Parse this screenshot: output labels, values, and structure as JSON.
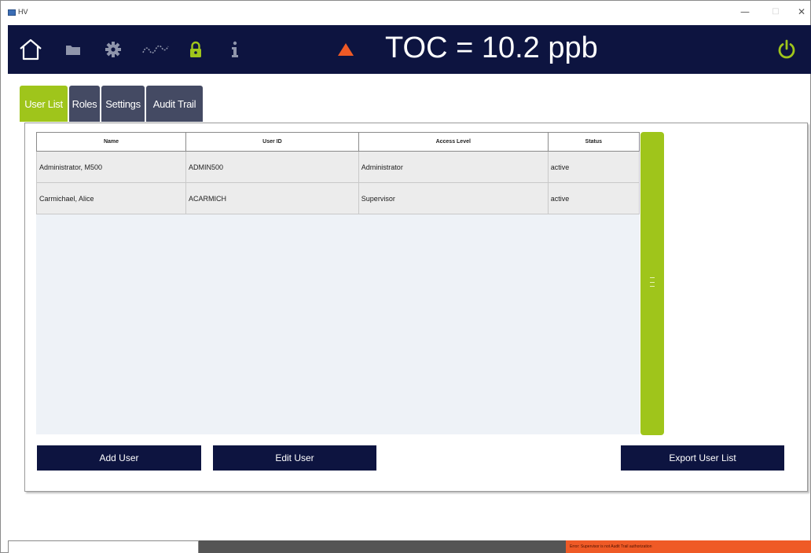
{
  "window": {
    "title": "HV"
  },
  "toolbar": {
    "toc_label": "TOC = 10.2 ppb",
    "icons": [
      "home-icon",
      "folder-icon",
      "gear-icon",
      "trend-icon",
      "lock-icon",
      "info-icon",
      "alarm-triangle-icon",
      "power-icon"
    ],
    "colors": {
      "bar": "#0d1440",
      "accent": "#9fc51b",
      "alarm": "#ef5a26"
    }
  },
  "tabs": [
    {
      "label": "User List",
      "active": true
    },
    {
      "label": "Roles",
      "active": false
    },
    {
      "label": "Settings",
      "active": false
    },
    {
      "label": "Audit Trail",
      "active": false
    }
  ],
  "table": {
    "columns": [
      "Name",
      "User ID",
      "Access Level",
      "Status"
    ],
    "rows": [
      [
        "Administrator, M500",
        "ADMIN500",
        "Administrator",
        "active"
      ],
      [
        "Carmichael, Alice",
        "ACARMICH",
        "Supervisor",
        "active"
      ]
    ]
  },
  "buttons": {
    "add_user": "Add User",
    "edit_user": "Edit User",
    "export_user_list": "Export User List"
  },
  "status_bar": {
    "error_text": "Error: Supervisor is not Audit Trail authorization"
  }
}
